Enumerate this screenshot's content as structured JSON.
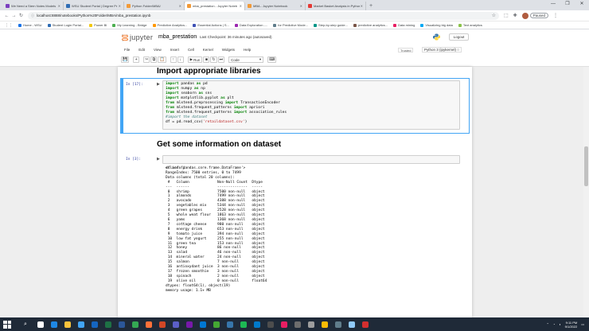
{
  "browser": {
    "tabs": [
      {
        "label": "We Need a Stern Notes Models",
        "color": "#7b3fbf"
      },
      {
        "label": "WSU Student Portal | Degree Pr",
        "color": "#2f6db5"
      },
      {
        "label": "Python Folder/MBA/",
        "color": "#f29a38"
      },
      {
        "label": "mba_prestation - Jupyter Noteb",
        "color": "#f29a38",
        "active": true
      },
      {
        "label": "MBA - Jupyter Notebook",
        "color": "#f29a38"
      },
      {
        "label": "Market Basket Analysis in Python",
        "color": "#e53935"
      }
    ],
    "new_tab": "+",
    "window_controls": [
      "—",
      "❐",
      "✕"
    ],
    "url": "localhost:8888/notebooks/Python%20Folder/MBA/mba_prestation.ipynb",
    "profile_label": "Paused",
    "bookmarks": [
      {
        "label": "Home - WSU",
        "color": "#1a73e8"
      },
      {
        "label": "Student Login Portal...",
        "color": "#2f6db5"
      },
      {
        "label": "Power BI",
        "color": "#f2c811"
      },
      {
        "label": "My Learning - Bridge",
        "color": "#4caf50"
      },
      {
        "label": "Predictive Analytics...",
        "color": "#ff9800"
      },
      {
        "label": "Essential Actions | S...",
        "color": "#3f51b5"
      },
      {
        "label": "Data Exploration -...",
        "color": "#9c27b0"
      },
      {
        "label": "for Predictive Mode...",
        "color": "#607d8b"
      },
      {
        "label": "Step-by-step guide...",
        "color": "#009688"
      },
      {
        "label": "predictive analytics...",
        "color": "#795548"
      },
      {
        "label": "Data mining",
        "color": "#e91e63"
      },
      {
        "label": "Visualizing big data",
        "color": "#03a9f4"
      },
      {
        "label": "Text analytics",
        "color": "#8bc34a"
      }
    ]
  },
  "jupyter": {
    "logo_text": "jupyter",
    "notebook_name": "mba_prestation",
    "checkpoint": "Last Checkpoint: 36 minutes ago  (autosaved)",
    "logout": "Logout",
    "menu": [
      "File",
      "Edit",
      "View",
      "Insert",
      "Cell",
      "Kernel",
      "Widgets",
      "Help"
    ],
    "trusted": "Trusted",
    "kernel": "Python 3 (ipykernel)",
    "toolbar": {
      "buttons": [
        "💾",
        "+",
        "✂",
        "⧉",
        "📋",
        "↑",
        "↓"
      ],
      "run_label": "Run",
      "stop": "■",
      "restart": "↻",
      "fastforward": "⏭",
      "cell_type": "Code",
      "keyboard": "⌨"
    }
  },
  "notebook": {
    "heading1": "Import appropriate libraries",
    "cell1_prompt": "In [17]:",
    "cell1_code": [
      [
        {
          "t": "import",
          "c": "kw"
        },
        {
          "t": " pandas "
        },
        {
          "t": "as",
          "c": "kw"
        },
        {
          "t": " pd"
        }
      ],
      [
        {
          "t": "import",
          "c": "kw"
        },
        {
          "t": " numpy "
        },
        {
          "t": "as",
          "c": "kw"
        },
        {
          "t": " np"
        }
      ],
      [
        {
          "t": "import",
          "c": "kw"
        },
        {
          "t": " seaborn "
        },
        {
          "t": "as",
          "c": "kw"
        },
        {
          "t": " sns"
        }
      ],
      [
        {
          "t": "import",
          "c": "kw"
        },
        {
          "t": " matplotlib.pyplot "
        },
        {
          "t": "as",
          "c": "kw"
        },
        {
          "t": " plt"
        }
      ],
      [
        {
          "t": "from",
          "c": "kw"
        },
        {
          "t": " mlxtend.preprocessing "
        },
        {
          "t": "import",
          "c": "kw"
        },
        {
          "t": " TransactionEncoder"
        }
      ],
      [
        {
          "t": "from",
          "c": "kw"
        },
        {
          "t": " mlxtend.frequent_patterns "
        },
        {
          "t": "import",
          "c": "kw"
        },
        {
          "t": " apriori"
        }
      ],
      [
        {
          "t": "from",
          "c": "kw"
        },
        {
          "t": " mlxtend.frequent_patterns "
        },
        {
          "t": "import",
          "c": "kw"
        },
        {
          "t": " association_rules"
        }
      ],
      [
        {
          "t": "#import the dataset",
          "c": "cm"
        }
      ],
      [
        {
          "t": "df = pd.read_csv("
        },
        {
          "t": "'retaildataset.csv'",
          "c": "st"
        },
        {
          "t": ")"
        }
      ]
    ],
    "heading2": "Get some information on dataset",
    "cell2_prompt": "In [3]:",
    "cell2_code": "df.info()",
    "output_lines": [
      "<class 'pandas.core.frame.DataFrame'>",
      "RangeIndex: 7500 entries, 0 to 7499",
      "Data columns (total 20 columns):",
      " #   Column             Non-Null Count  Dtype  ",
      "---  ------             --------------  -----  ",
      " 0   shrimp             7500 non-null   object ",
      " 1   almonds            7499 non-null   object ",
      " 2   avocado            4388 non-null   object ",
      " 3   vegetables mix     5344 non-null   object ",
      " 4   green grapes       2528 non-null   object ",
      " 5   whole weat flour   1863 non-null   object ",
      " 6   yams               1368 non-null   object ",
      " 7   cottage cheese     980 non-null    object ",
      " 8   energy drink       653 non-null    object ",
      " 9   tomato juice       394 non-null    object ",
      " 10  low fat yogurt     255 non-null    object ",
      " 11  green tea          153 non-null    object ",
      " 12  honey              86 non-null     object ",
      " 13  salad              46 non-null     object ",
      " 14  mineral water      24 non-null     object ",
      " 15  salmon             7 non-null      object ",
      " 16  antioxydant juice  3 non-null      object ",
      " 17  frozen smoothie    3 non-null      object ",
      " 18  spinach            2 non-null      object ",
      " 19  olive oil          0 non-null      float64",
      "dtypes: float64(1), object(19)",
      "memory usage: 1.1+ MB"
    ]
  },
  "taskbar": {
    "apps": [
      {
        "name": "task-view",
        "color": "#ffffff"
      },
      {
        "name": "edge",
        "color": "#1e88e5"
      },
      {
        "name": "file-explorer",
        "color": "#f9c23c"
      },
      {
        "name": "store",
        "color": "#42a5f5"
      },
      {
        "name": "mail",
        "color": "#1565c0"
      },
      {
        "name": "excel",
        "color": "#1e7145"
      },
      {
        "name": "word",
        "color": "#2b579a"
      },
      {
        "name": "chrome",
        "color": "#34a853"
      },
      {
        "name": "firefox",
        "color": "#ff7139"
      },
      {
        "name": "powerpoint",
        "color": "#d24726"
      },
      {
        "name": "teams",
        "color": "#5b5fc7"
      },
      {
        "name": "onenote",
        "color": "#7719aa"
      },
      {
        "name": "outlook",
        "color": "#0078d4"
      },
      {
        "name": "anaconda",
        "color": "#44a833"
      },
      {
        "name": "python",
        "color": "#3776ab"
      },
      {
        "name": "spotify",
        "color": "#1db954"
      },
      {
        "name": "vscode",
        "color": "#007acc"
      },
      {
        "name": "terminal",
        "color": "#4d4d4d"
      },
      {
        "name": "paint",
        "color": "#e91e63"
      },
      {
        "name": "calculator",
        "color": "#6d6d6d"
      },
      {
        "name": "camera",
        "color": "#9e9e9e"
      },
      {
        "name": "chrome-2",
        "color": "#fbbc05"
      },
      {
        "name": "settings",
        "color": "#607d8b"
      },
      {
        "name": "notepad",
        "color": "#90caf9"
      },
      {
        "name": "acrobat",
        "color": "#d32f2f"
      }
    ],
    "time": "9:11 PM",
    "date": "9/1/2022"
  }
}
